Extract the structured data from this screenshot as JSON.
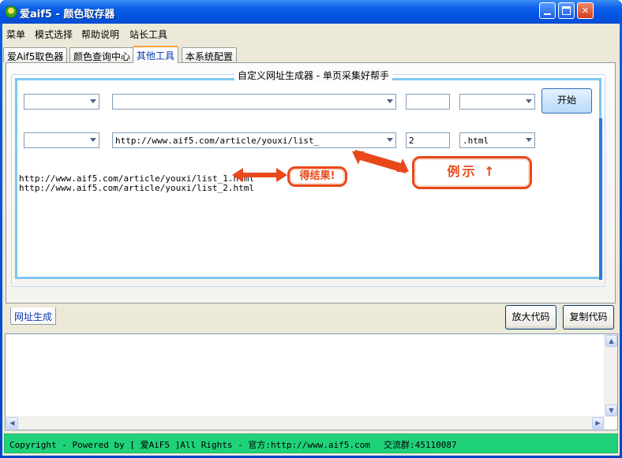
{
  "window": {
    "title": "爱aif5 - 颜色取存器"
  },
  "menu": [
    "菜单",
    "模式选择",
    "帮助说明",
    "站长工具"
  ],
  "tabs": [
    "爱Aif5取色器",
    "颜色查询中心",
    "其他工具",
    "本系统配置"
  ],
  "active_tab": "其他工具",
  "group_title": "自定义网址生成器 - 单页采集好帮手",
  "row1": {
    "prefix": "",
    "url": "",
    "count": "",
    "suffix": ""
  },
  "start_button": "开始",
  "row2": {
    "prefix": "",
    "url": "http://www.aif5.com/article/youxi/list_",
    "count": "2",
    "suffix": ".html"
  },
  "results": [
    "http://www.aif5.com/article/youxi/list_1.html",
    "http://www.aif5.com/article/youxi/list_2.html"
  ],
  "annotations": {
    "result_badge": "得结果!",
    "example_badge": "例示 ↑"
  },
  "lower_tab": "网址生成",
  "buttons": {
    "enlarge": "放大代码",
    "copy": "复制代码"
  },
  "status": {
    "copyright": "Copyright - Powered by [ 爱AiF5 ]All Rights - 官方:http://www.aif5.com",
    "group": "交流群:45110087"
  },
  "colors": {
    "title_bar": "#0053e0",
    "status_bar": "#1fd27a",
    "badge": "#e8481a",
    "group_border": "#7fc6f0"
  }
}
